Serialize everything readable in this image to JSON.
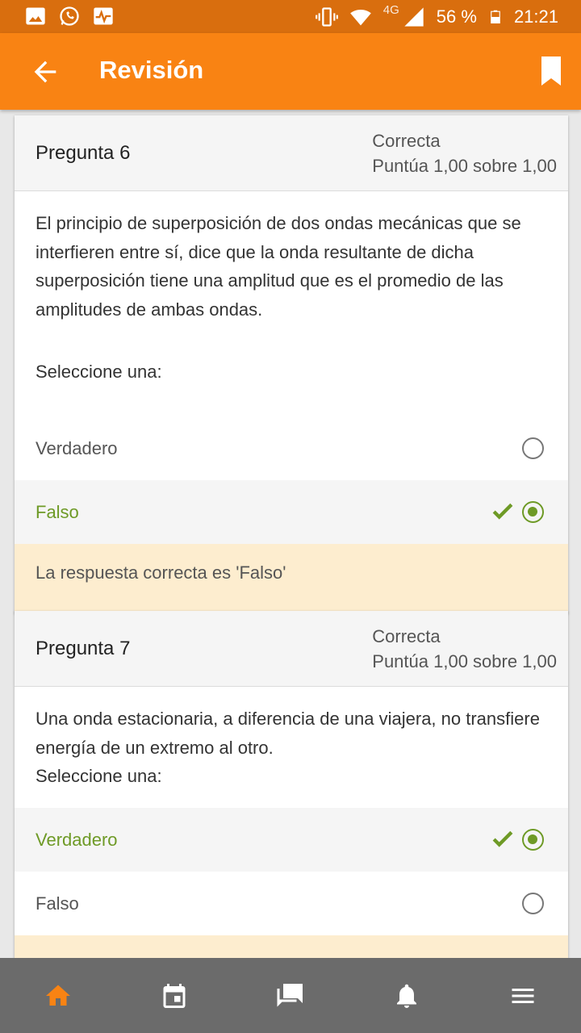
{
  "status_bar": {
    "network": "4G",
    "battery": "56 %",
    "time": "21:21",
    "icons": [
      "gallery-icon",
      "whatsapp-icon",
      "activity-icon",
      "vibrate-icon",
      "wifi-icon",
      "signal-icon",
      "battery-icon"
    ]
  },
  "app_bar": {
    "title": "Revisión",
    "back_icon": "arrow-left-icon",
    "bookmark_icon": "bookmark-icon"
  },
  "questions": [
    {
      "title": "Pregunta 6",
      "state": "Correcta",
      "grade": "Puntúa 1,00 sobre 1,00",
      "text": "El principio de superposición de dos ondas mecánicas que se interfieren entre sí, dice que la onda resultante de dicha superposición tiene una amplitud que es el promedio de las amplitudes de ambas ondas.",
      "select_label": "Seleccione una:",
      "options": [
        {
          "label": "Verdadero",
          "selected": false
        },
        {
          "label": "Falso",
          "selected": true,
          "correct": true
        }
      ],
      "feedback": "La respuesta correcta es 'Falso'"
    },
    {
      "title": "Pregunta 7",
      "state": "Correcta",
      "grade": "Puntúa 1,00 sobre 1,00",
      "text": "Una onda estacionaria, a diferencia de una viajera, no transfiere energía de un extremo al otro.",
      "select_label": "Seleccione una:",
      "options": [
        {
          "label": "Verdadero",
          "selected": true,
          "correct": true
        },
        {
          "label": "Falso",
          "selected": false
        }
      ]
    }
  ],
  "bottom_nav": {
    "items": [
      "home-icon",
      "calendar-icon",
      "messages-icon",
      "notifications-icon",
      "menu-icon"
    ],
    "active_color": "#f98313",
    "inactive_color": "#ffffff"
  },
  "colors": {
    "status_bar": "#d96e0e",
    "app_bar": "#f98313",
    "correct": "#6e9a26",
    "feedback_bg": "#fdedcf"
  }
}
